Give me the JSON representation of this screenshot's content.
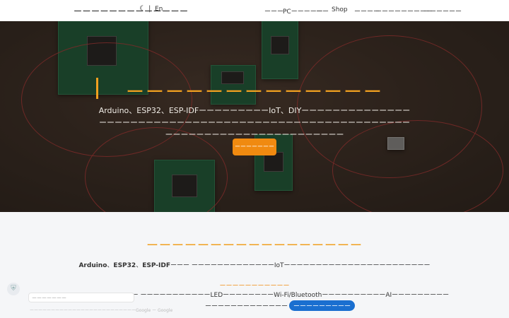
{
  "header": {
    "brand": "ーーーーーーーーーーーーー",
    "theme_icon": "moon-icon",
    "separator": "|",
    "lang": "En",
    "nav": [
      "ーーー",
      "PCーーーーー",
      "ーー",
      "Shop",
      "ーーーー",
      "ーーー",
      "ーーーーーー",
      "ーーーーーー"
    ]
  },
  "hero": {
    "title": "ーーーーーーーーーーーーー",
    "text": "Arduino、ESP32、ESP-IDFーーーーーーーーーIoT、DIYーーーーーーーーーーーーーーーーーーーーーーーーーーーーーーーーーーーーーーーーーーーーーーーーーーーーーーーーーーーーーーーーーーーーーーーーーーーーー",
    "button": "ーーーーーーー",
    "accent_color": "#f0a020"
  },
  "section": {
    "title": "ーーーーーーーーーーーーーーーーー",
    "desc_bold1": "Arduino",
    "desc_mid1": "、",
    "desc_bold2": "ESP32",
    "desc_mid2": "、",
    "desc_bold3": "ESP-IDF",
    "desc_rest": "ーーー ーーーーーーーーーーーーーIoTーーーーーーーーーーーーーーーーーーーーーーー",
    "subheading": "ーーーーーーーーーーー",
    "subtext": "ーーーー ーーーーーーーー ーーーーーーーーーーーLEDーーーーーーーーWi-Fi/BluetoothーーーーーーーーーーAIーーーーーーーーー",
    "last_text": "ーーーーーーーーーーーーー",
    "pill": "ーーーーーーーーー"
  },
  "consent": {
    "label": "ーーーーーーー",
    "subtext": "ーーーーーーーーーーーーーーーーーーーーーーーーーGoogle ー Google"
  }
}
